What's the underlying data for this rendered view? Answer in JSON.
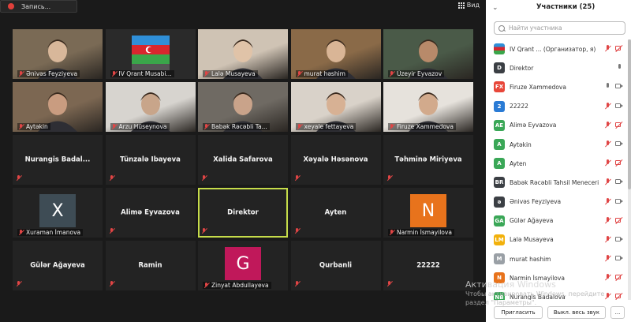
{
  "recording": {
    "label": "Запись..."
  },
  "view": {
    "label": "Вид"
  },
  "tiles": [
    {
      "name": "Ənivəs Feyziyeva",
      "type": "video",
      "bg": "#7a6a55",
      "face": "#d8b79a"
    },
    {
      "name": "IV Qrant Musabi...",
      "type": "flag"
    },
    {
      "name": "Lalə Musayeva",
      "type": "video",
      "bg": "#cfc3b4",
      "face": "#e0c3a8"
    },
    {
      "name": "murat həshim",
      "type": "video",
      "bg": "#8a6a48",
      "face": "#d9b596"
    },
    {
      "name": "Üzeyir Eyvazov",
      "type": "video",
      "bg": "#4a5a48",
      "face": "#b88a6a"
    },
    {
      "name": "Aytəkin",
      "type": "video",
      "bg": "#7c6752",
      "face": "#c99c80"
    },
    {
      "name": "Arzu Hüseynova",
      "type": "video",
      "bg": "#d7d4cf",
      "face": "#c8a58a"
    },
    {
      "name": "Babək Rəcəbli Ta...",
      "type": "video",
      "bg": "#6f6a63",
      "face": "#c9a38a"
    },
    {
      "name": "xeyale fettayeva",
      "type": "video",
      "bg": "#d9d2c9",
      "face": "#d7b194"
    },
    {
      "name": "Firuze Xammedova",
      "type": "video",
      "bg": "#e6e2dc",
      "face": "#d2aa8c"
    },
    {
      "name": "Nurangis  Badal...",
      "type": "name"
    },
    {
      "name": "Tünzalə İbayeva",
      "type": "name"
    },
    {
      "name": "Xalida Safarova",
      "type": "name"
    },
    {
      "name": "Xəyalə Həsənova",
      "type": "name"
    },
    {
      "name": "Təhminə Miriyeva",
      "type": "name"
    },
    {
      "name": "Xuraman İmanova",
      "type": "avatar",
      "letter": "X",
      "color": "#3e4c55"
    },
    {
      "name": "Alimə Eyvazova",
      "type": "name"
    },
    {
      "name": "Direktor",
      "type": "name",
      "active": true
    },
    {
      "name": "Ayten",
      "type": "name"
    },
    {
      "name": "Narmin İsmayilova",
      "type": "avatar",
      "letter": "N",
      "color": "#e8731c"
    },
    {
      "name": "Gülər Ağayeva",
      "type": "name"
    },
    {
      "name": "Ramin",
      "type": "name"
    },
    {
      "name": "Zinyat Abdullayeva",
      "type": "avatar",
      "letter": "G",
      "color": "#c0185a"
    },
    {
      "name": "Qurbanli",
      "type": "name"
    },
    {
      "name": "22222",
      "type": "name"
    }
  ],
  "panel": {
    "title": "Участники (25)",
    "search_placeholder": "Найти участника",
    "participants": [
      {
        "initials": "",
        "name": "IV Qrant ... (Организатор, я)",
        "color": "flag",
        "mic": "off",
        "cam": "off"
      },
      {
        "initials": "D",
        "name": "Direktor",
        "color": "#3b3f44",
        "mic": "on",
        "cam": "none"
      },
      {
        "initials": "FX",
        "name": "Firuze Xammedova",
        "color": "#e8473a",
        "mic": "on",
        "cam": "on"
      },
      {
        "initials": "2",
        "name": "22222",
        "color": "#2a7bd5",
        "mic": "off",
        "cam": "on"
      },
      {
        "initials": "AE",
        "name": "Alimə Eyvazova",
        "color": "#3aa757",
        "mic": "off",
        "cam": "off"
      },
      {
        "initials": "A",
        "name": "Aytəkin",
        "color": "#3aa757",
        "mic": "off",
        "cam": "on"
      },
      {
        "initials": "A",
        "name": "Ayten",
        "color": "#3aa757",
        "mic": "off",
        "cam": "off"
      },
      {
        "initials": "BR",
        "name": "Babək Rəcəbli Tahsil Meneceri",
        "color": "#3b3f44",
        "mic": "off",
        "cam": "on"
      },
      {
        "initials": "ə",
        "name": "Ənivəs Feyziyeva",
        "color": "#3b3f44",
        "mic": "off",
        "cam": "on"
      },
      {
        "initials": "GA",
        "name": "Gülər Ağayeva",
        "color": "#3aa757",
        "mic": "off",
        "cam": "off"
      },
      {
        "initials": "LM",
        "name": "Lalə Musayeva",
        "color": "#f2b10c",
        "mic": "off",
        "cam": "on"
      },
      {
        "initials": "M",
        "name": "murat həshim",
        "color": "#9aa0a6",
        "mic": "off",
        "cam": "on"
      },
      {
        "initials": "N",
        "name": "Narmin İsmayilova",
        "color": "#e8731c",
        "mic": "off",
        "cam": "off"
      },
      {
        "initials": "NB",
        "name": "Nurangis Badalova",
        "color": "#3aa757",
        "mic": "off",
        "cam": "off"
      }
    ],
    "invite_label": "Пригласить",
    "mute_all_label": "Выкл. весь звук",
    "more_label": "..."
  },
  "watermark": {
    "line1": "Активация Windows",
    "line2": "Чтобы активировать Windows, перейдите",
    "line3": "раздел \"Параметры\"."
  }
}
